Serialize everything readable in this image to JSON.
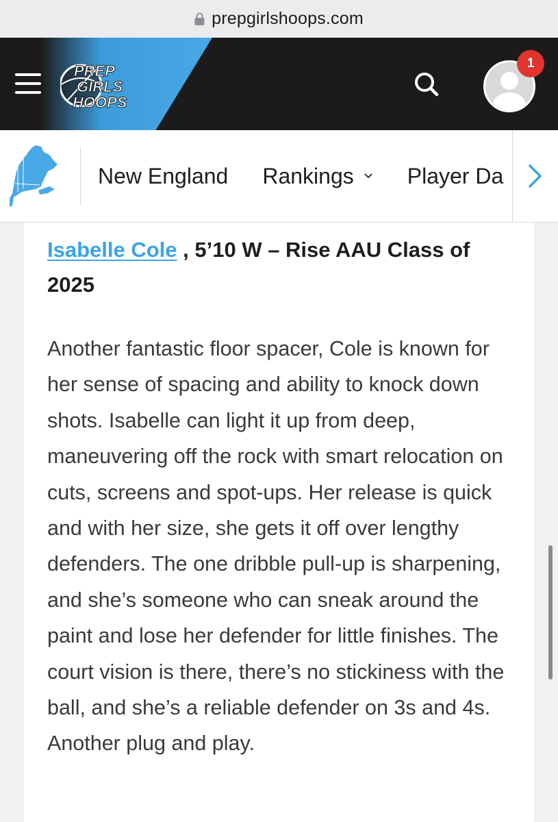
{
  "browser": {
    "url": "prepgirlshoops.com",
    "lock_icon": "lock-icon"
  },
  "header": {
    "menu_icon": "hamburger-menu-icon",
    "logo_text": [
      "PREP",
      "GIRLS",
      "HOOPS"
    ],
    "search_icon": "search-icon",
    "notification_count": "1",
    "colors": {
      "background": "#1b1b1b",
      "accent": "#49a8e6",
      "badge": "#e0342f"
    }
  },
  "subnav": {
    "region_icon": "new-england-map-icon",
    "items": [
      {
        "label": "New England"
      },
      {
        "label": "Rankings",
        "has_dropdown": true
      },
      {
        "label": "Player Da"
      }
    ],
    "next_icon": "chevron-right-icon"
  },
  "article": {
    "player_name": "Isabelle Cole",
    "player_details": " , 5’10 W – Rise AAU Class of 2025",
    "body": "Another fantastic floor spacer, Cole is known for her sense of spacing and ability to knock down shots. Isabelle can light it up from deep, maneuvering off the rock with smart relocation on cuts, screens and spot-ups. Her release is quick and with her size, she gets it off over lengthy defenders. The one dribble pull-up is sharpening, and she’s someone who can sneak around the paint and lose her defender for little finishes. The court vision is there, there’s no stickiness with the ball, and she’s a reliable defender on 3s and 4s. Another plug and play."
  }
}
